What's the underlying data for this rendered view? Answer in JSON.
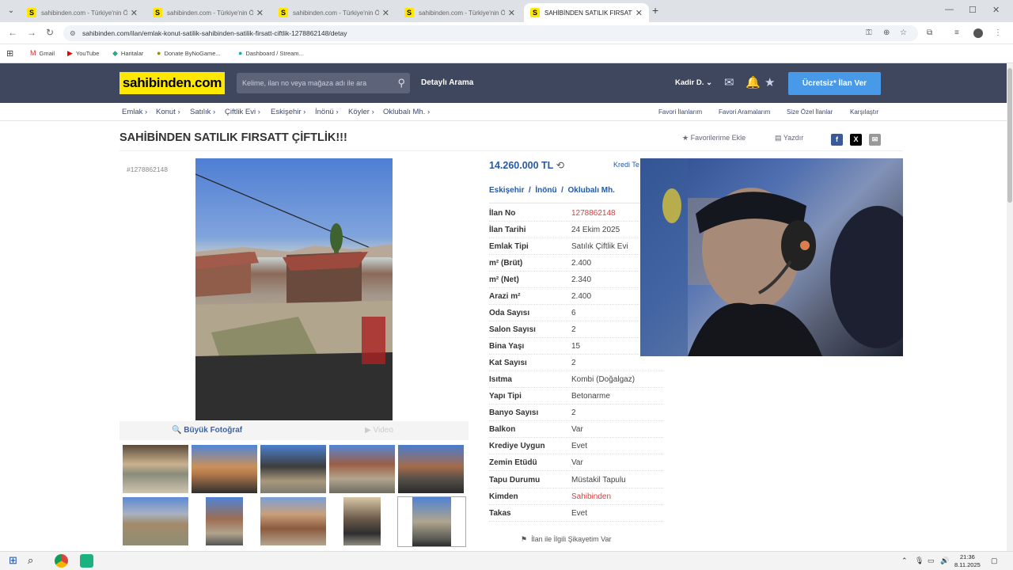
{
  "browser": {
    "tabs": [
      {
        "favicon": "S",
        "title": "sahibinden.com - Türkiye'nin Ö..."
      },
      {
        "favicon": "S",
        "title": "sahibinden.com - Türkiye'nin Ö..."
      },
      {
        "favicon": "S",
        "title": "sahibinden.com - Türkiye'nin Ö..."
      },
      {
        "favicon": "S",
        "title": "sahibinden.com - Türkiye'nin Ö..."
      },
      {
        "favicon": "S",
        "title": "SAHİBİNDEN SATILIK FIRSATT Ç..."
      }
    ],
    "active_tab": 4,
    "url": "sahibinden.com/ilan/emlak-konut-satilik-sahibinden-satilik-firsatt-ciftlik-1278862148/detay",
    "bookmarks": [
      "Gmail",
      "YouTube",
      "Haritalar",
      "Donate ByNoGame...",
      "Dashboard / Stream..."
    ]
  },
  "site": {
    "logo": "sahibinden.com",
    "search_placeholder": "Kelime, ilan no veya mağaza adı ile ara",
    "detailed_search": "Detaylı Arama",
    "user": "Kadir D.",
    "post_button": "Ücretsiz* İlan Ver"
  },
  "breadcrumb": [
    "Emlak",
    "Konut",
    "Satılık",
    "Çiftlik Evi",
    "Eskişehir",
    "İnönü",
    "Köyler",
    "Oklubalı Mh."
  ],
  "breadcrumb_links": [
    "Favori İlanlarım",
    "Favori Aramalarım",
    "Size Özel İlanlar",
    "Karşılaştır"
  ],
  "listing": {
    "title": "SAHİBİNDEN SATILIK FIRSATT ÇİFTLİK!!!",
    "favorite": "Favorilerime Ekle",
    "print": "Yazdır",
    "number_label": "#1278862148",
    "price": "14.260.000 TL",
    "kredi": "Kredi Te",
    "location": [
      "Eskişehir",
      "İnönü",
      "Oklubalı Mh."
    ],
    "gallery_photo": "Büyük Fotoğraf",
    "gallery_video": "Video",
    "complaint": "İlan ile İlgili Şikayetim Var",
    "details": [
      {
        "k": "İlan No",
        "v": "1278862148",
        "red": true
      },
      {
        "k": "İlan Tarihi",
        "v": "24 Ekim 2025"
      },
      {
        "k": "Emlak Tipi",
        "v": "Satılık Çiftlik Evi"
      },
      {
        "k": "m² (Brüt)",
        "v": "2.400"
      },
      {
        "k": "m² (Net)",
        "v": "2.340"
      },
      {
        "k": "Arazi m²",
        "v": "2.400"
      },
      {
        "k": "Oda Sayısı",
        "v": "6"
      },
      {
        "k": "Salon Sayısı",
        "v": "2"
      },
      {
        "k": "Bina Yaşı",
        "v": "15"
      },
      {
        "k": "Kat Sayısı",
        "v": "2"
      },
      {
        "k": "Isıtma",
        "v": "Kombi (Doğalgaz)"
      },
      {
        "k": "Yapı Tipi",
        "v": "Betonarme"
      },
      {
        "k": "Banyo Sayısı",
        "v": "2"
      },
      {
        "k": "Balkon",
        "v": "Var"
      },
      {
        "k": "Krediye Uygun",
        "v": "Evet"
      },
      {
        "k": "Zemin Etüdü",
        "v": "Var"
      },
      {
        "k": "Tapu Durumu",
        "v": "Müstakil Tapulu"
      },
      {
        "k": "Kimden",
        "v": "Sahibinden",
        "red": true
      },
      {
        "k": "Takas",
        "v": "Evet"
      }
    ]
  },
  "taskbar": {
    "time": "21:36",
    "date": "8.11.2025"
  }
}
